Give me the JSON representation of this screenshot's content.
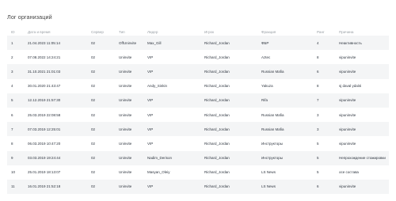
{
  "title": "Лог организаций",
  "table": {
    "columns": [
      "ID",
      "Дата и время",
      "Сервер",
      "Тип",
      "Лидер",
      "Игрок",
      "Фракция",
      "Ранг",
      "Причина"
    ],
    "rows": [
      [
        "1",
        "21.04.2023 11:05:14",
        "02",
        "OffUninvite",
        "Max_Gill",
        "Richard_Jordan",
        "ФБР",
        "4",
        "Неактивность"
      ],
      [
        "2",
        "07.08.2022 14:24:21",
        "02",
        "Uninvite",
        "VIP",
        "Richard_Jordan",
        "Aztec",
        "8",
        "vipuninvite"
      ],
      [
        "3",
        "31.10.2021 21:01:03",
        "02",
        "Uninvite",
        "VIP",
        "Richard_Jordan",
        "Russian Mafia",
        "6",
        "vipuninvite"
      ],
      [
        "4",
        "30.01.2020 21:43:47",
        "02",
        "Uninvite",
        "Andy_Sinkin",
        "Richard_Jordan",
        "Yakuza",
        "8",
        "sj daval ydal4i"
      ],
      [
        "5",
        "12.12.2019 21:57:30",
        "02",
        "Uninvite",
        "VIP",
        "Richard_Jordan",
        "Rifa",
        "7",
        "vipuninvite"
      ],
      [
        "6",
        "25.03.2019 22:08:58",
        "02",
        "Uninvite",
        "VIP",
        "Richard_Jordan",
        "Russian Mafia",
        "3",
        "vipuninvite"
      ],
      [
        "7",
        "07.03.2019 12:25:01",
        "02",
        "Uninvite",
        "VIP",
        "Richard_Jordan",
        "Russian Mafia",
        "3",
        "vipuninvite"
      ],
      [
        "8",
        "06.03.2019 10:47:20",
        "02",
        "Uninvite",
        "VIP",
        "Richard_Jordan",
        "Инструкторы",
        "5",
        "vipuninvite"
      ],
      [
        "9",
        "03.03.2019 19:24:44",
        "02",
        "Uninvite",
        "Nadim_Derison",
        "Richard_Jordan",
        "Инструкторы",
        "5",
        "Непрохождение стажировки"
      ],
      [
        "10",
        "25.01.2019 18:13:07",
        "02",
        "Uninvite",
        "Masyan_Oleiy",
        "Richard_Jordan",
        "LS News",
        "5",
        "осе состава"
      ],
      [
        "11",
        "16.01.2019 21:52:18",
        "02",
        "Uninvite",
        "VIP",
        "Richard_Jordan",
        "LS News",
        "6",
        "vipuninvite"
      ]
    ]
  }
}
